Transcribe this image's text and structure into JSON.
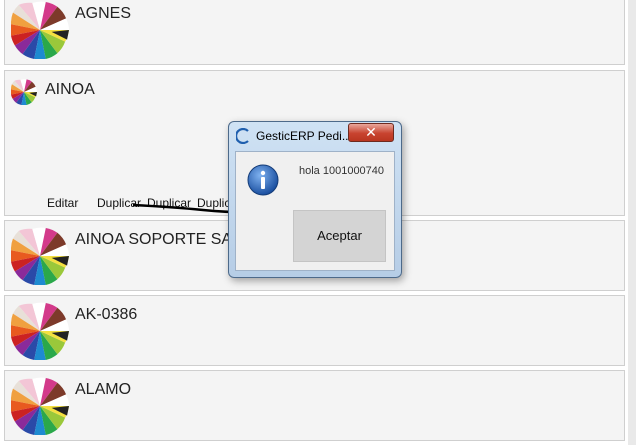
{
  "customers": [
    {
      "name": "AGNES"
    },
    {
      "name": "AINOA",
      "actions": [
        "Editar",
        "Duplicar",
        "Duplicar",
        "Duplic"
      ]
    },
    {
      "name": "AINOA SOPORTE SAR"
    },
    {
      "name": "AK-0386"
    },
    {
      "name": "ALAMO"
    }
  ],
  "dialog": {
    "title": "GesticERP Pedi...",
    "close": "✕",
    "message": "hola 1001000740",
    "button": "Aceptar",
    "info_icon": "info-icon"
  },
  "colors": {
    "accent": "#1f5fae",
    "close": "#c8432f",
    "card_bg": "#f4f4f4"
  }
}
